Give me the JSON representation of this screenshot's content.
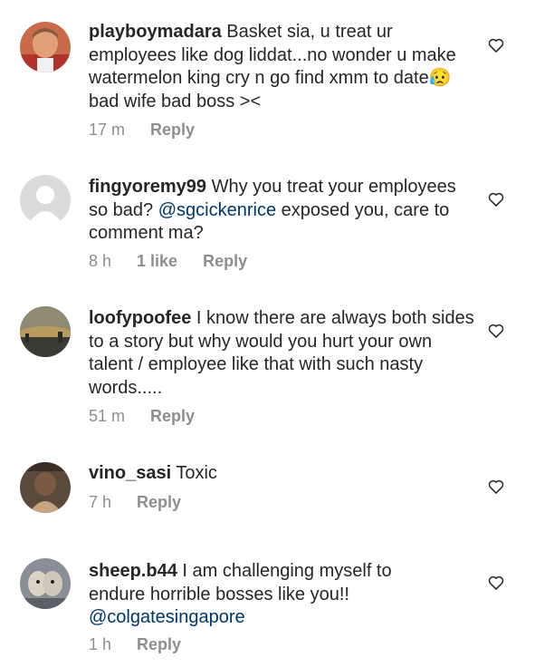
{
  "comments": [
    {
      "username": "playboymadara",
      "text_a": " Basket sia, u treat ur employees like dog liddat...no wonder u make watermelon king cry n go find xmm to date",
      "emoji": "😥",
      "text_b": " bad wife bad boss ><",
      "time": "17 m",
      "reply": "Reply"
    },
    {
      "username": "fingyoremy99",
      "text_a": " Why you treat your employees so bad? ",
      "mention": "@sgcickenrice",
      "text_b": " exposed you, care to comment ma?",
      "time": "8 h",
      "likes": "1 like",
      "reply": "Reply"
    },
    {
      "username": "loofypoofee",
      "text_a": " I know there are always both sides to a story but why would you hurt your own talent / employee like that with such nasty words.....",
      "time": "51 m",
      "reply": "Reply"
    },
    {
      "username": "vino_sasi",
      "text_a": " Toxic",
      "time": "7 h",
      "reply": "Reply"
    },
    {
      "username": "sheep.b44",
      "text_a": " I am challenging myself to endure horrible bosses like you!!",
      "mention": "@colgatesingapore",
      "time": "1 h",
      "reply": "Reply"
    }
  ],
  "colors": {
    "text": "#262626",
    "meta": "#8e8e8e",
    "mention": "#00376b"
  },
  "icons": {
    "like": "heart-outline-icon"
  }
}
